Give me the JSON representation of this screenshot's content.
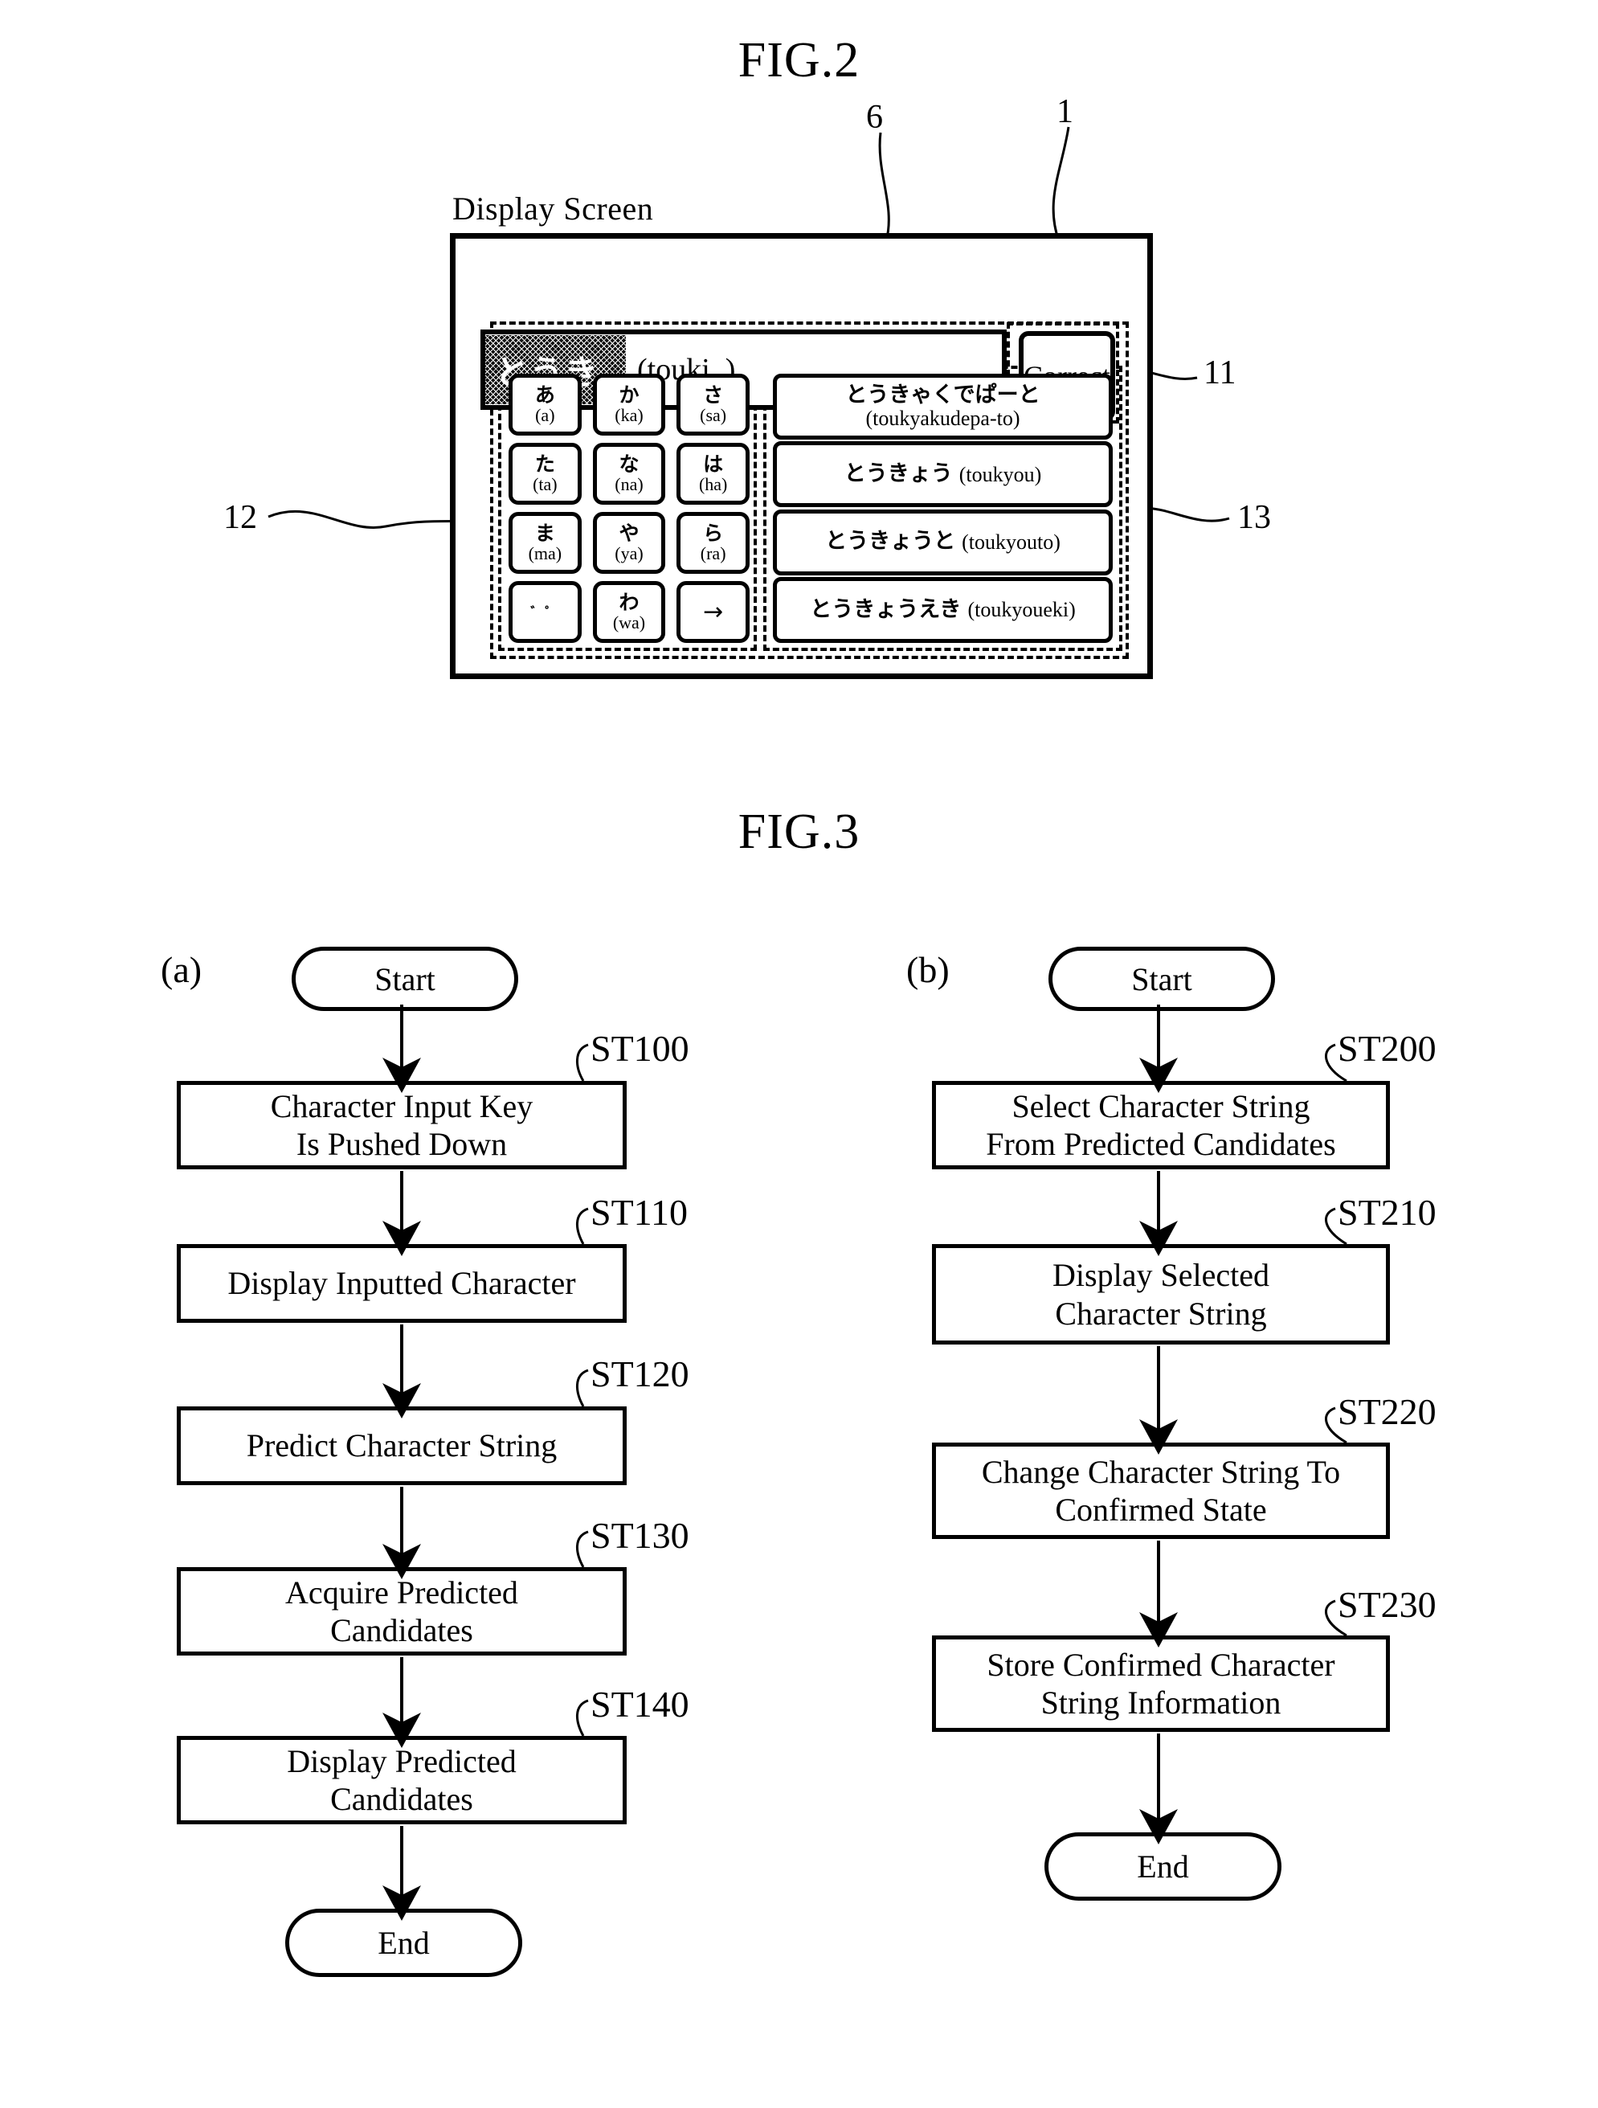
{
  "figures": {
    "fig2": {
      "title": "FIG.2"
    },
    "fig3": {
      "title": "FIG.3"
    }
  },
  "fig2": {
    "display_screen_label": "Display Screen",
    "reference_numerals": {
      "device": "1",
      "entry_field": "6",
      "correct_button": "11",
      "keypad_region": "12",
      "candidate_region": "13"
    },
    "entry_field": {
      "highlighted_text": "とうき_",
      "romaji_text": "(touki_)"
    },
    "correct_button_label": "Correct",
    "keypad_keys": [
      {
        "kana": "あ",
        "roma": "(a)"
      },
      {
        "kana": "か",
        "roma": "(ka)"
      },
      {
        "kana": "さ",
        "roma": "(sa)"
      },
      {
        "kana": "た",
        "roma": "(ta)"
      },
      {
        "kana": "な",
        "roma": "(na)"
      },
      {
        "kana": "は",
        "roma": "(ha)"
      },
      {
        "kana": "ま",
        "roma": "(ma)"
      },
      {
        "kana": "や",
        "roma": "(ya)"
      },
      {
        "kana": "ら",
        "roma": "(ra)"
      },
      {
        "kana": "゛゜",
        "roma": ""
      },
      {
        "kana": "わ",
        "roma": "(wa)"
      },
      {
        "kana": "→",
        "roma": ""
      }
    ],
    "predicted_candidates": [
      {
        "kana": "とうきゃくでぱーと",
        "roma": "(toukyakudepa-to)",
        "two_line": true
      },
      {
        "kana": "とうきょう",
        "roma": "(toukyou)",
        "two_line": false
      },
      {
        "kana": "とうきょうと",
        "roma": "(toukyouto)",
        "two_line": false
      },
      {
        "kana": "とうきょうえき",
        "roma": "(toukyoueki)",
        "two_line": false
      }
    ]
  },
  "fig3": {
    "flow_a": {
      "label": "(a)",
      "start": "Start",
      "end": "End",
      "steps": [
        {
          "id": "ST100",
          "text": "Character Input Key\nIs Pushed Down"
        },
        {
          "id": "ST110",
          "text": "Display Inputted Character"
        },
        {
          "id": "ST120",
          "text": "Predict Character String"
        },
        {
          "id": "ST130",
          "text": "Acquire Predicted\nCandidates"
        },
        {
          "id": "ST140",
          "text": "Display Predicted\nCandidates"
        }
      ]
    },
    "flow_b": {
      "label": "(b)",
      "start": "Start",
      "end": "End",
      "steps": [
        {
          "id": "ST200",
          "text": "Select Character String\nFrom Predicted Candidates"
        },
        {
          "id": "ST210",
          "text": "Display Selected\nCharacter String"
        },
        {
          "id": "ST220",
          "text": "Change Character String To\nConfirmed State"
        },
        {
          "id": "ST230",
          "text": "Store Confirmed Character\nString Information"
        }
      ]
    }
  },
  "colors": {
    "ink": "#000000",
    "paper": "#ffffff"
  }
}
